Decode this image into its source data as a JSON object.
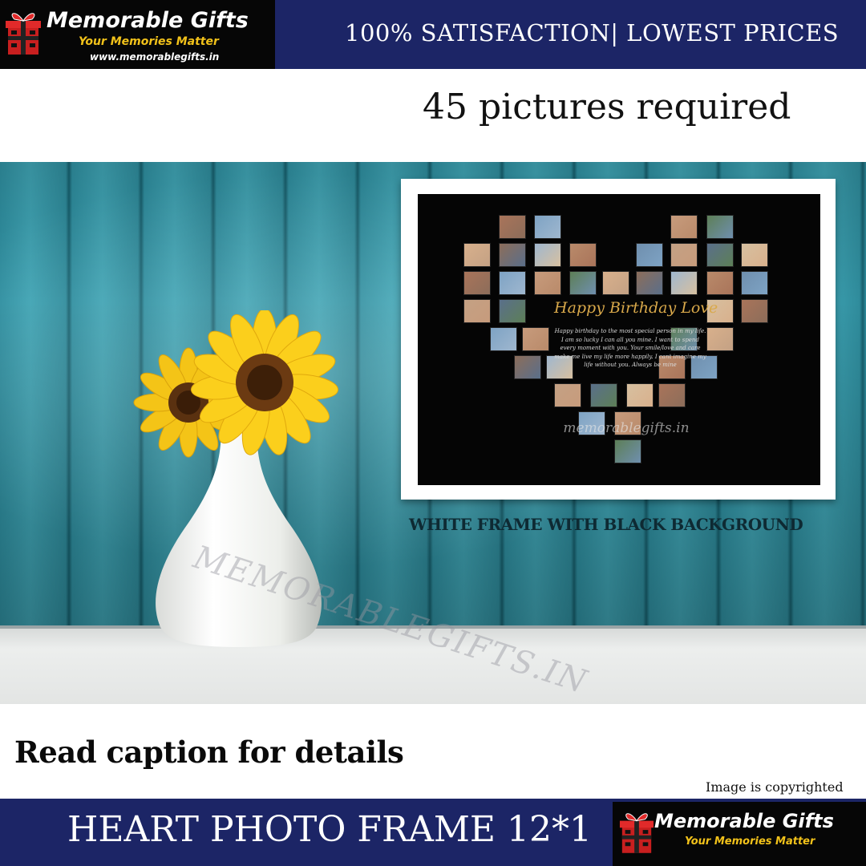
{
  "brand": {
    "name": "Memorable Gifts",
    "tagline": "Your Memories Matter",
    "url": "www.memorablegifts.in"
  },
  "banner": {
    "promo": "100% SATISFACTION| LOWEST PRICES"
  },
  "headline": "45 pictures required",
  "frame": {
    "card_title": "Happy Birthday Love",
    "card_message": "Happy birthday to the most special person in my life. I am so lucky I can all you mine. I want to spend every moment with you. Your smile/love and care make me live my life more happily. I cant imagine my life without you. Always be mine",
    "card_watermark": "memorablegifts.in",
    "caption": "WHITE FRAME WITH BLACK BACKGROUND"
  },
  "scene": {
    "vase_watermark": "MEMORABLEGIFTS.IN"
  },
  "footer": {
    "read_caption": "Read caption for details",
    "copyright": "Image is copyrighted",
    "product_title": "HEART PHOTO FRAME 12*1"
  },
  "colors": {
    "navy": "#1c2566",
    "gold": "#f2c21a",
    "teal_wall": "#3fa3b3"
  }
}
